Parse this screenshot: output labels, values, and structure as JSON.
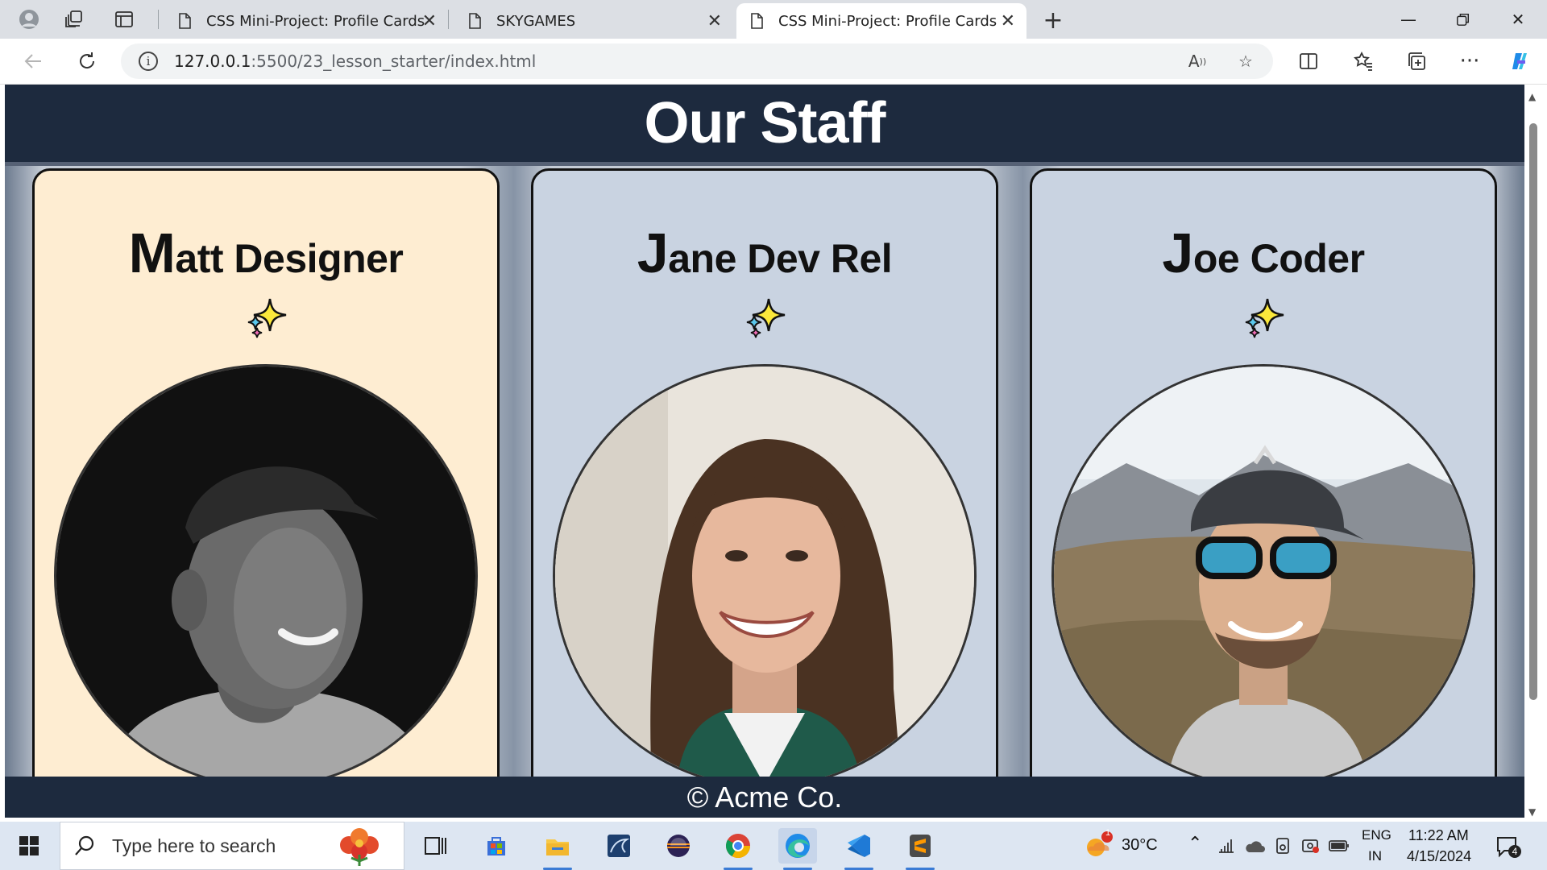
{
  "browser": {
    "tabs": [
      {
        "title": "CSS Mini-Project: Profile Cards",
        "active": false
      },
      {
        "title": "SKYGAMES",
        "active": false
      },
      {
        "title": "CSS Mini-Project: Profile Cards",
        "active": true
      }
    ],
    "address": {
      "host": "127.0.0.1",
      "path": ":5500/23_lesson_starter/index.html"
    }
  },
  "page": {
    "title": "Our Staff",
    "cards": [
      {
        "initial": "M",
        "rest": "att Designer",
        "theme": "#feedd2"
      },
      {
        "initial": "J",
        "rest": "ane Dev Rel",
        "theme": "#c9d3e1"
      },
      {
        "initial": "J",
        "rest": "oe Coder",
        "theme": "#c9d3e1"
      }
    ],
    "sparkle": "sparkles-emoji",
    "footer": "© Acme Co."
  },
  "taskbar": {
    "search_placeholder": "Type here to search",
    "weather": {
      "temp": "30°C",
      "badge": "1"
    },
    "language": {
      "line1": "ENG",
      "line2": "IN"
    },
    "clock": {
      "time": "11:22 AM",
      "date": "4/15/2024"
    },
    "notifications": "4"
  },
  "colors": {
    "header_bg": "#1d2a3e",
    "card_bg": "#c9d3e1",
    "card_warm_bg": "#feedd2"
  }
}
